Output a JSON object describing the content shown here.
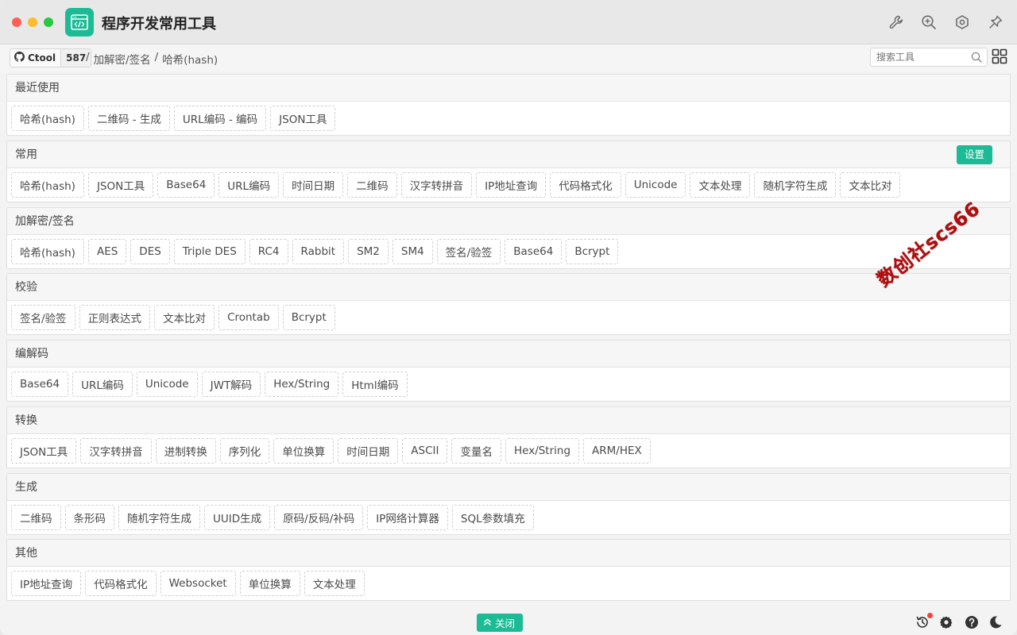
{
  "window": {
    "title": "程序开发常用工具",
    "logo_icon": "code-window-icon",
    "brand_color": "#1cbb96"
  },
  "toolbar_icons": [
    "wrench-icon",
    "zoom-in-icon",
    "plugin-hex-icon",
    "pin-icon"
  ],
  "navbar": {
    "github_label": "Ctool",
    "github_count": "587",
    "breadcrumb": [
      "加解密/签名",
      "哈希(hash)"
    ],
    "separator": "/",
    "search_placeholder": "搜索工具"
  },
  "sections": [
    {
      "title": "最近使用",
      "items": [
        "哈希(hash)",
        "二维码 - 生成",
        "URL编码 - 编码",
        "JSON工具"
      ]
    },
    {
      "title": "常用",
      "action": "设置",
      "items": [
        "哈希(hash)",
        "JSON工具",
        "Base64",
        "URL编码",
        "时间日期",
        "二维码",
        "汉字转拼音",
        "IP地址查询",
        "代码格式化",
        "Unicode",
        "文本处理",
        "随机字符生成",
        "文本比对"
      ]
    },
    {
      "title": "加解密/签名",
      "items": [
        "哈希(hash)",
        "AES",
        "DES",
        "Triple DES",
        "RC4",
        "Rabbit",
        "SM2",
        "SM4",
        "签名/验签",
        "Base64",
        "Bcrypt"
      ]
    },
    {
      "title": "校验",
      "items": [
        "签名/验签",
        "正则表达式",
        "文本比对",
        "Crontab",
        "Bcrypt"
      ]
    },
    {
      "title": "编解码",
      "items": [
        "Base64",
        "URL编码",
        "Unicode",
        "JWT解码",
        "Hex/String",
        "Html编码"
      ]
    },
    {
      "title": "转换",
      "items": [
        "JSON工具",
        "汉字转拼音",
        "进制转换",
        "序列化",
        "单位换算",
        "时间日期",
        "ASCII",
        "变量名",
        "Hex/String",
        "ARM/HEX"
      ]
    },
    {
      "title": "生成",
      "items": [
        "二维码",
        "条形码",
        "随机字符生成",
        "UUID生成",
        "原码/反码/补码",
        "IP网络计算器",
        "SQL参数填充"
      ]
    },
    {
      "title": "其他",
      "items": [
        "IP地址查询",
        "代码格式化",
        "Websocket",
        "单位换算",
        "文本处理"
      ]
    }
  ],
  "watermark": "数创社scs66",
  "bottom": {
    "close_label": "关闭",
    "icons": [
      "history-icon",
      "settings-gear-icon",
      "help-icon",
      "dark-mode-moon-icon"
    ]
  }
}
